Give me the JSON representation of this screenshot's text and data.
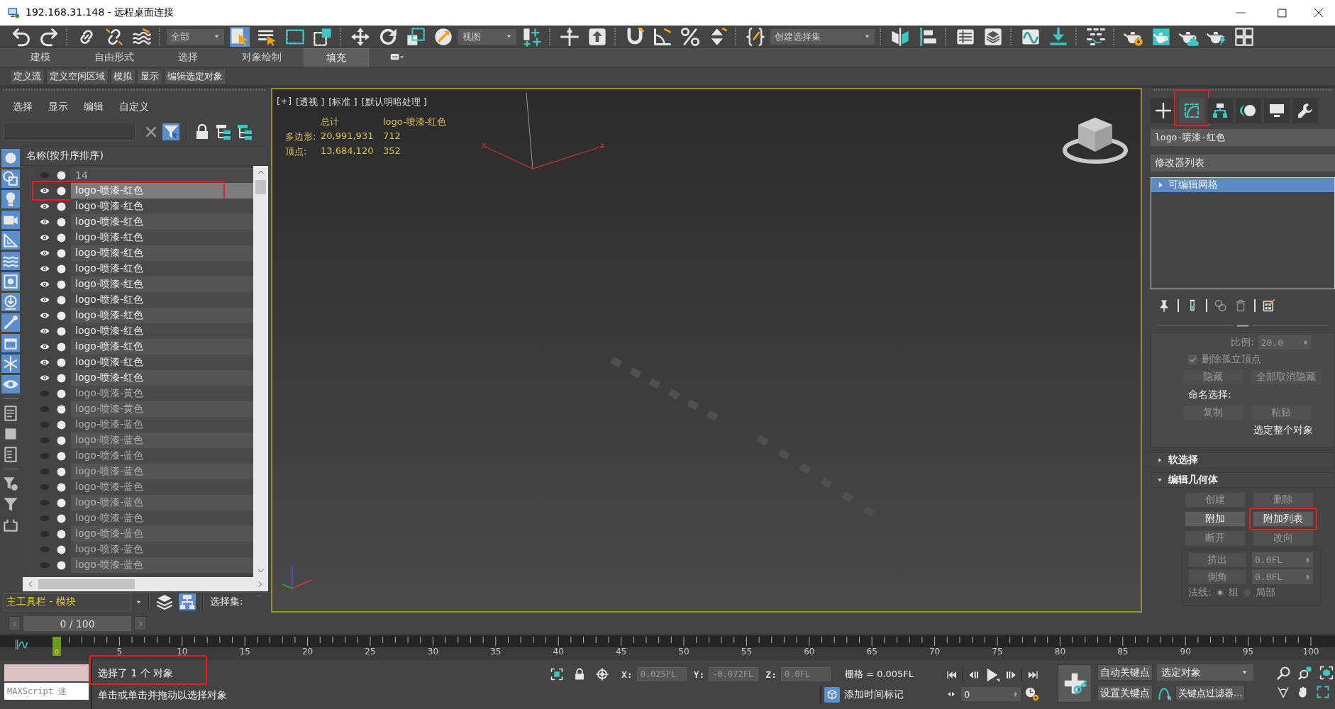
{
  "window": {
    "title": "192.168.31.148 - 远程桌面连接"
  },
  "main_toolbar": {
    "items": [
      {
        "kind": "icon",
        "selected": false
      },
      {
        "kind": "icon",
        "selected": false
      },
      {
        "kind": "icon",
        "selected": false
      },
      {
        "kind": "icon",
        "selected": false
      },
      {
        "kind": "icon",
        "selected": false
      },
      {
        "kind": "dropdown",
        "value": "全部"
      },
      {
        "kind": "icon",
        "selected": true
      },
      {
        "kind": "icon",
        "selected": false
      },
      {
        "kind": "icon",
        "selected": false
      },
      {
        "kind": "icon",
        "selected": false
      },
      {
        "kind": "icon",
        "selected": false
      },
      {
        "kind": "icon",
        "selected": false
      },
      {
        "kind": "icon",
        "selected": false
      },
      {
        "kind": "icon",
        "selected": false
      },
      {
        "kind": "dropdown",
        "value": "视图"
      },
      {
        "kind": "icon",
        "selected": false
      },
      {
        "kind": "icon",
        "selected": false
      },
      {
        "kind": "icon",
        "selected": false
      },
      {
        "kind": "icon",
        "selected": false
      },
      {
        "kind": "icon",
        "selected": false
      },
      {
        "kind": "icon",
        "selected": false
      },
      {
        "kind": "icon",
        "selected": false
      },
      {
        "kind": "icon",
        "selected": false
      },
      {
        "kind": "dropdown",
        "value": "创建选择集"
      },
      {
        "kind": "icon",
        "selected": false
      },
      {
        "kind": "icon",
        "selected": false
      },
      {
        "kind": "icon",
        "selected": false
      },
      {
        "kind": "icon",
        "selected": false
      },
      {
        "kind": "icon",
        "selected": false
      },
      {
        "kind": "icon",
        "selected": false
      },
      {
        "kind": "icon",
        "selected": false
      },
      {
        "kind": "icon",
        "selected": false
      },
      {
        "kind": "icon",
        "selected": false
      },
      {
        "kind": "icon",
        "selected": false
      },
      {
        "kind": "icon",
        "selected": false
      },
      {
        "kind": "icon",
        "selected": false
      }
    ]
  },
  "ribbon": {
    "tabs": [
      {
        "label": "建模",
        "selected": false
      },
      {
        "label": "自由形式",
        "selected": false
      },
      {
        "label": "选择",
        "selected": false
      },
      {
        "label": "对象绘制",
        "selected": false
      },
      {
        "label": "填充",
        "selected": true
      }
    ],
    "buttons": [
      "定义流",
      "定义空闲区域",
      "模拟",
      "显示",
      "编辑选定对象"
    ]
  },
  "scene_explorer": {
    "menus": [
      "选择",
      "显示",
      "编辑",
      "自定义"
    ],
    "tools": [
      {
        "selected": false
      },
      {
        "selected": true
      },
      {
        "selected": false
      },
      {
        "selected": false
      },
      {
        "selected": false
      }
    ],
    "filters": [
      {
        "on": true
      },
      {
        "on": true
      },
      {
        "on": true
      },
      {
        "on": true
      },
      {
        "on": true
      },
      {
        "on": true
      },
      {
        "on": true
      },
      {
        "on": true
      },
      {
        "on": true
      },
      {
        "on": true
      },
      {
        "on": true
      },
      {
        "on": true
      },
      {
        "on": false
      },
      {
        "on": false
      },
      {
        "on": false
      },
      {
        "on": false
      },
      {
        "on": false
      },
      {
        "on": false
      }
    ],
    "column_header": "名称(按升序排序)",
    "rows": [
      {
        "name": "14",
        "visible": false,
        "selected": false,
        "highlighted": false
      },
      {
        "name": "logo-喷漆-红色",
        "visible": true,
        "selected": true,
        "highlighted": true
      },
      {
        "name": "logo-喷漆-红色",
        "visible": true,
        "selected": false,
        "highlighted": false
      },
      {
        "name": "logo-喷漆-红色",
        "visible": true,
        "selected": false,
        "highlighted": false
      },
      {
        "name": "logo-喷漆-红色",
        "visible": true,
        "selected": false,
        "highlighted": false
      },
      {
        "name": "logo-喷漆-红色",
        "visible": true,
        "selected": false,
        "highlighted": false
      },
      {
        "name": "logo-喷漆-红色",
        "visible": true,
        "selected": false,
        "highlighted": false
      },
      {
        "name": "logo-喷漆-红色",
        "visible": true,
        "selected": false,
        "highlighted": false
      },
      {
        "name": "logo-喷漆-红色",
        "visible": true,
        "selected": false,
        "highlighted": false
      },
      {
        "name": "logo-喷漆-红色",
        "visible": true,
        "selected": false,
        "highlighted": false
      },
      {
        "name": "logo-喷漆-红色",
        "visible": true,
        "selected": false,
        "highlighted": false
      },
      {
        "name": "logo-喷漆-红色",
        "visible": true,
        "selected": false,
        "highlighted": false
      },
      {
        "name": "logo-喷漆-红色",
        "visible": true,
        "selected": false,
        "highlighted": false
      },
      {
        "name": "logo-喷漆-红色",
        "visible": true,
        "selected": false,
        "highlighted": false
      },
      {
        "name": "logo-喷漆-黄色",
        "visible": false,
        "selected": false,
        "highlighted": false
      },
      {
        "name": "logo-喷漆-黄色",
        "visible": false,
        "selected": false,
        "highlighted": false
      },
      {
        "name": "logo-喷漆-蓝色",
        "visible": false,
        "selected": false,
        "highlighted": false
      },
      {
        "name": "logo-喷漆-蓝色",
        "visible": false,
        "selected": false,
        "highlighted": false
      },
      {
        "name": "logo-喷漆-蓝色",
        "visible": false,
        "selected": false,
        "highlighted": false
      },
      {
        "name": "logo-喷漆-蓝色",
        "visible": false,
        "selected": false,
        "highlighted": false
      },
      {
        "name": "logo-喷漆-蓝色",
        "visible": false,
        "selected": false,
        "highlighted": false
      },
      {
        "name": "logo-喷漆-蓝色",
        "visible": false,
        "selected": false,
        "highlighted": false
      },
      {
        "name": "logo-喷漆-蓝色",
        "visible": false,
        "selected": false,
        "highlighted": false
      },
      {
        "name": "logo-喷漆-蓝色",
        "visible": false,
        "selected": false,
        "highlighted": false
      },
      {
        "name": "logo-喷漆-蓝色",
        "visible": false,
        "selected": false,
        "highlighted": false
      },
      {
        "name": "logo-喷漆-蓝色",
        "visible": false,
        "selected": false,
        "highlighted": false
      }
    ]
  },
  "layout_toolbar": {
    "dropdown": "主工具栏 - 模块",
    "tools": [
      {
        "selected": false
      },
      {
        "selected": true
      }
    ],
    "selection_set_label": "选择集:"
  },
  "viewport": {
    "labels": [
      "[+]",
      "[透视 ]",
      "[标准 ]",
      "[默认明暗处理 ]"
    ],
    "stats": {
      "headers": [
        "总计",
        "logo-喷漆-红色"
      ],
      "rows": [
        {
          "label": "多边形:",
          "values": [
            "20,991,931",
            "712"
          ]
        },
        {
          "label": "顶点:",
          "values": [
            "13,684,120",
            "352"
          ]
        }
      ]
    }
  },
  "command_panel": {
    "tabs": [
      {
        "selected": false,
        "highlighted": false
      },
      {
        "selected": true,
        "highlighted": true
      },
      {
        "selected": false,
        "highlighted": false
      },
      {
        "selected": false,
        "highlighted": false
      },
      {
        "selected": false,
        "highlighted": false
      },
      {
        "selected": false,
        "highlighted": false
      }
    ],
    "object_name": "logo-喷漆-红色",
    "modifier_list": "修改器列表",
    "stack": [
      {
        "label": "可编辑网格",
        "selected": true,
        "expanded": false
      }
    ],
    "selection": {
      "scale": {
        "label": "比例:",
        "value": "20.0",
        "disabled": true
      },
      "delete_isolated": {
        "label": "删除孤立顶点",
        "checked": true,
        "disabled": true
      },
      "hide_buttons": [
        {
          "label": "隐藏",
          "disabled": true
        },
        {
          "label": "全部取消隐藏",
          "disabled": true
        }
      ],
      "named_selection_label": "命名选择:",
      "named_buttons": [
        {
          "label": "复制",
          "disabled": true
        },
        {
          "label": "粘贴",
          "disabled": true
        }
      ],
      "info": "选定整个对象"
    },
    "rollouts": [
      {
        "title": "软选择",
        "expanded": false
      },
      {
        "title": "编辑几何体",
        "expanded": true,
        "buttons": [
          {
            "label": "创建",
            "disabled": true,
            "highlighted": false
          },
          {
            "label": "删除",
            "disabled": true,
            "highlighted": false
          },
          {
            "label": "附加",
            "disabled": false,
            "highlighted": false
          },
          {
            "label": "附加列表",
            "disabled": false,
            "highlighted": true
          },
          {
            "label": "断开",
            "disabled": true,
            "highlighted": false
          },
          {
            "label": "改向",
            "disabled": true,
            "highlighted": false
          }
        ],
        "spinners": [
          {
            "label": "挤出",
            "value": "0.0FL",
            "disabled": true
          },
          {
            "label": "倒角",
            "value": "0.0FL",
            "disabled": true
          }
        ],
        "normals": {
          "label": "法线:",
          "options": [
            {
              "label": "组",
              "selected": true
            },
            {
              "label": "局部",
              "selected": false
            }
          ]
        }
      }
    ]
  },
  "time_slider": {
    "value": "0 / 100",
    "level": 0
  },
  "track_bar": {
    "current": "0",
    "labels": [
      "5",
      "10",
      "15",
      "20",
      "25",
      "30",
      "35",
      "40",
      "45",
      "50",
      "55",
      "60",
      "65",
      "70",
      "75",
      "80",
      "85",
      "90",
      "95",
      "100"
    ]
  },
  "status_bar": {
    "listener": "MAXScript 迷",
    "selection_info": {
      "text": "选择了 1 个 对象",
      "highlighted": true
    },
    "prompt": "单击或单击并拖动以选择对象",
    "coordinates": [
      {
        "label": "X:",
        "value": "0.025FL"
      },
      {
        "label": "Y:",
        "value": "-0.072FL"
      },
      {
        "label": "Z:",
        "value": "0.0FL"
      }
    ],
    "grid": "栅格 = 0.005FL",
    "time_tag": "添加时间标记",
    "frame": "0",
    "auto_key": "自动关键点",
    "key_mode": "选定对象",
    "set_key": "设置关键点",
    "key_filters": "关键点过滤器..."
  }
}
